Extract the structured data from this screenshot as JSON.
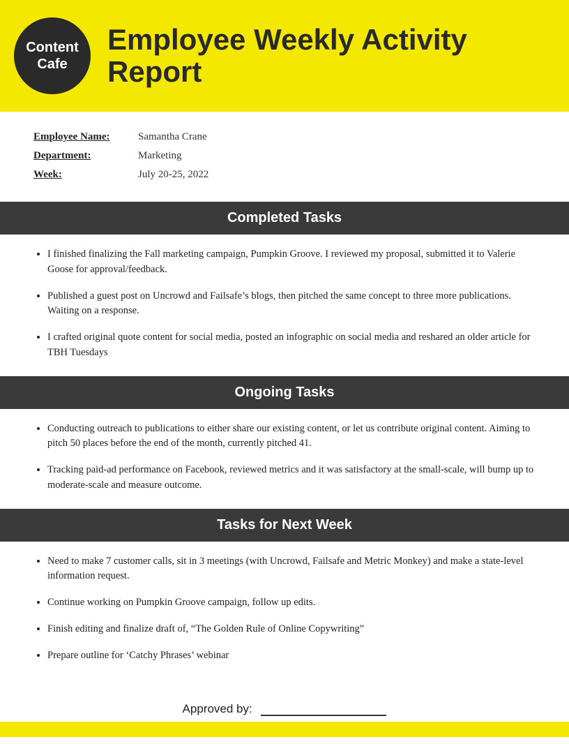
{
  "header": {
    "logo_line1": "Content",
    "logo_line2": "Cafe",
    "logo_sub": "cafe",
    "title": "Employee Weekly Activity Report"
  },
  "info": {
    "employee_label": "Employee Name:",
    "employee_value": "Samantha Crane",
    "department_label": "Department:",
    "department_value": "Marketing",
    "week_label": "Week:",
    "week_value": "July 20-25, 2022"
  },
  "sections": {
    "completed": {
      "title": "Completed Tasks",
      "items": [
        "I finished finalizing the Fall marketing campaign, Pumpkin Groove. I reviewed my proposal, submitted it to Valerie Goose for approval/feedback.",
        "Published a guest post on Uncrowd and Failsafe’s blogs, then pitched the same concept to three more publications. Waiting on a response.",
        "I crafted original quote content for social media, posted an infographic on social media and reshared an older article for TBH Tuesdays"
      ]
    },
    "ongoing": {
      "title": "Ongoing Tasks",
      "items": [
        "Conducting outreach to publications to either share our existing content, or let us contribute original content. Aiming to pitch 50 places before the end of the month, currently pitched 41.",
        "Tracking paid-ad performance on Facebook, reviewed metrics and it was satisfactory at the small-scale, will bump up to moderate-scale and measure outcome."
      ]
    },
    "next_week": {
      "title": "Tasks for Next Week",
      "items": [
        "Need to make 7 customer calls, sit in 3 meetings (with Uncrowd, Failsafe and Metric Monkey) and make a state-level information request.",
        "Continue working on Pumpkin Groove campaign, follow up edits.",
        "Finish editing and finalize draft of, “The Golden Rule of Online Copywriting”",
        "Prepare outline for ‘Catchy Phrases’ webinar"
      ]
    }
  },
  "approved": {
    "label": "Approved by:"
  }
}
